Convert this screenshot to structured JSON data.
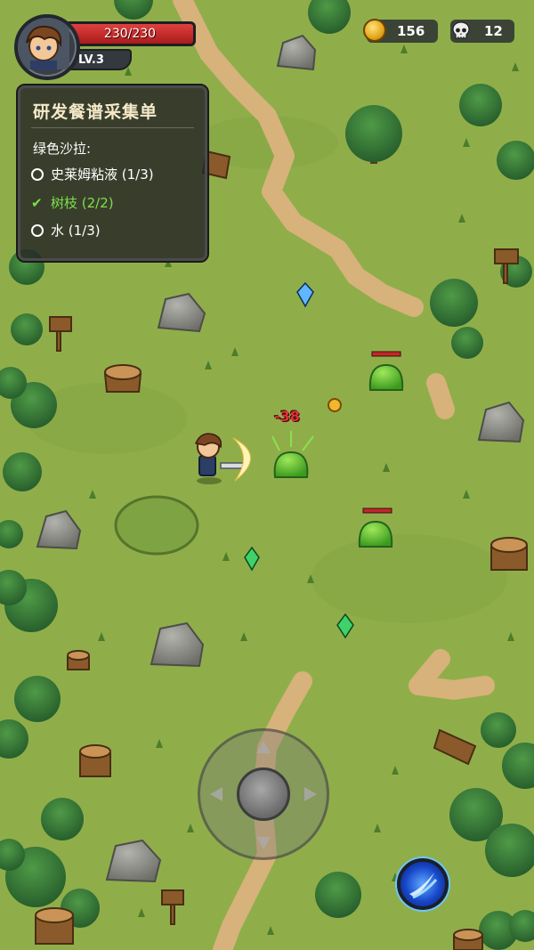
{
  "player": {
    "hp_text": "230/230",
    "hp_fraction": 1.0,
    "level_text": "LV.3"
  },
  "currency": {
    "coins": "156",
    "kills": "12"
  },
  "quest": {
    "title": "研发餐谱采集单",
    "recipe": "绿色沙拉:",
    "items": [
      {
        "label": "史莱姆粘液 (1/3)",
        "done": false
      },
      {
        "label": "树枝 (2/2)",
        "done": true
      },
      {
        "label": "水 (1/3)",
        "done": false
      }
    ]
  },
  "combat": {
    "damage_text": "-38"
  },
  "colors": {
    "grass": "#8fae4a",
    "path": "#d7b27a",
    "hp": "#d12e2e",
    "done": "#7ee04a",
    "slime": "#6fcf3c"
  },
  "icons": {
    "coin": "coin-icon",
    "kills": "skull-icon",
    "skill": "slash-skill-icon"
  }
}
